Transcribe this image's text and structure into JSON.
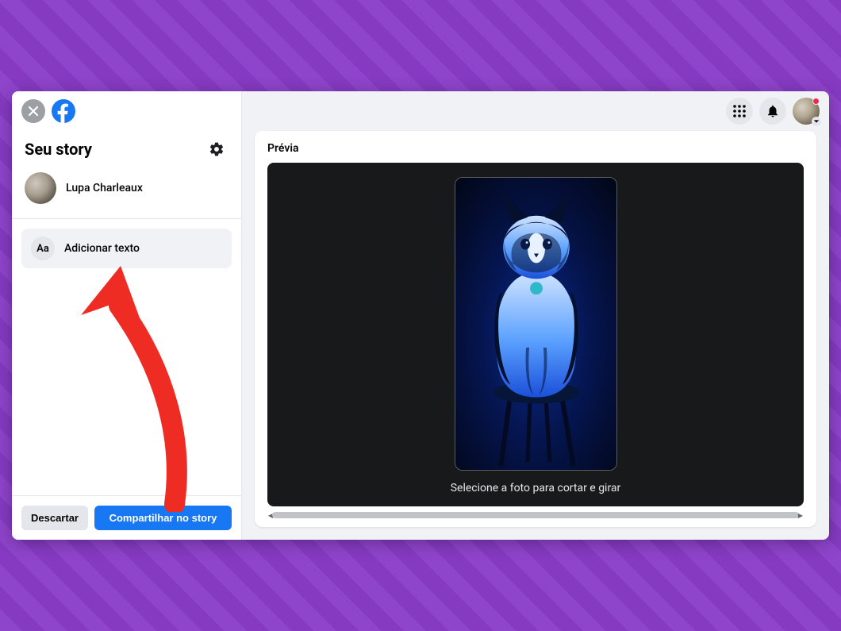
{
  "sidebar": {
    "title": "Seu story",
    "user_name": "Lupa Charleaux",
    "add_text_icon": "Aa",
    "add_text_label": "Adicionar texto",
    "discard_label": "Descartar",
    "share_label": "Compartilhar no story"
  },
  "preview": {
    "title": "Prévia",
    "instruction": "Selecione a foto para cortar e girar"
  },
  "colors": {
    "brand_blue": "#1877f2",
    "accent_red": "#f02849",
    "annotation_red": "#ee2c24"
  }
}
